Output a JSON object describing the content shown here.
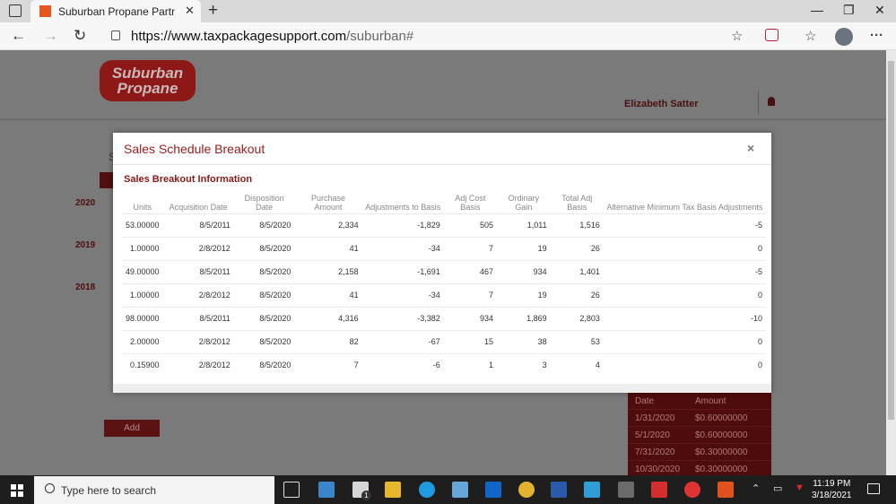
{
  "browser": {
    "tab_title": "Suburban Propane Partners, L.P.",
    "new_tab": "+",
    "url_host": "https://www.taxpackagesupport.com",
    "url_path": "/suburban#",
    "menu": "···"
  },
  "page": {
    "logo_line1": "Suburban",
    "logo_line2": "Propane",
    "username": "Elizabeth Satter",
    "years": [
      "2020",
      "2019",
      "2018"
    ],
    "partial_letter": "S",
    "add_button": "Add",
    "distributions": {
      "headers": [
        "Date",
        "Amount"
      ],
      "rows": [
        [
          "1/31/2020",
          "$0.60000000"
        ],
        [
          "5/1/2020",
          "$0.60000000"
        ],
        [
          "7/31/2020",
          "$0.30000000"
        ],
        [
          "10/30/2020",
          "$0.30000000"
        ]
      ]
    }
  },
  "modal": {
    "title": "Sales Schedule Breakout",
    "close": "×",
    "section_title": "Sales Breakout Information",
    "columns": [
      "Units",
      "Acquisition Date",
      "Disposition Date",
      "Purchase Amount",
      "Adjustments to Basis",
      "Adj Cost Basis",
      "Ordinary Gain",
      "Total Adj Basis",
      "Alternative Minimum Tax Basis Adjustments"
    ],
    "rows": [
      [
        "53.00000",
        "8/5/2011",
        "8/5/2020",
        "2,334",
        "-1,829",
        "505",
        "1,011",
        "1,516",
        "-5"
      ],
      [
        "1.00000",
        "2/8/2012",
        "8/5/2020",
        "41",
        "-34",
        "7",
        "19",
        "26",
        "0"
      ],
      [
        "49.00000",
        "8/5/2011",
        "8/5/2020",
        "2,158",
        "-1,691",
        "467",
        "934",
        "1,401",
        "-5"
      ],
      [
        "1.00000",
        "2/8/2012",
        "8/5/2020",
        "41",
        "-34",
        "7",
        "19",
        "26",
        "0"
      ],
      [
        "98.00000",
        "8/5/2011",
        "8/5/2020",
        "4,316",
        "-3,382",
        "934",
        "1,869",
        "2,803",
        "-10"
      ],
      [
        "2.00000",
        "2/8/2012",
        "8/5/2020",
        "82",
        "-67",
        "15",
        "38",
        "53",
        "0"
      ],
      [
        "0.15900",
        "2/8/2012",
        "8/5/2020",
        "7",
        "-6",
        "1",
        "3",
        "4",
        "0"
      ]
    ]
  },
  "taskbar": {
    "search_placeholder": "Type here to search",
    "time": "11:19 PM",
    "date": "3/18/2021",
    "mail_badge": "1"
  },
  "colors": {
    "brand": "#9b1c1c",
    "logo_bg": "#8d1818"
  }
}
